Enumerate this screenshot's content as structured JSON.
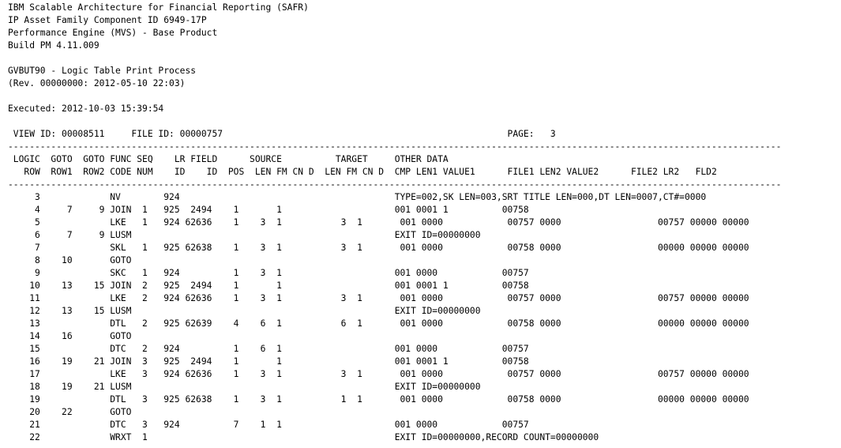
{
  "header": [
    "IBM Scalable Architecture for Financial Reporting (SAFR)",
    "IP Asset Family Component ID 6949-17P",
    "Performance Engine (MVS) - Base Product",
    "Build PM 4.11.009",
    "",
    "GVBUT90 - Logic Table Print Process",
    "(Rev. 00000000: 2012-05-10 22:03)",
    "",
    "Executed: 2012-10-03 15:39:54",
    "",
    " VIEW ID: 00008511     FILE ID: 00000757                                                     PAGE:   3"
  ],
  "rule": "------------------------------------------------------------------------------------------------------------------------------------------------",
  "column_headers": [
    " LOGIC  GOTO  GOTO FUNC SEQ    LR FIELD      SOURCE          TARGET     OTHER DATA",
    "   ROW  ROW1  ROW2 CODE NUM    ID    ID  POS  LEN FM CN D  LEN FM CN D  CMP LEN1 VALUE1      FILE1 LEN2 VALUE2      FILE2 LR2   FLD2"
  ],
  "rows": [
    "     3             NV        924                                        TYPE=002,SK LEN=003,SRT TITLE LEN=000,DT LEN=0007,CT#=0000",
    "     4     7     9 JOIN  1   925  2494    1       1                     001 0001 1          00758",
    "     5             LKE   1   924 62636    1    3  1           3  1       001 0000            00757 0000                  00757 00000 00000",
    "     6     7     9 LUSM                                                 EXIT ID=00000000",
    "     7             SKL   1   925 62638    1    3  1           3  1       001 0000            00758 0000                  00000 00000 00000",
    "     8    10       GOTO",
    "     9             SKC   1   924          1    3  1                     001 0000            00757",
    "    10    13    15 JOIN  2   925  2494    1       1                     001 0001 1          00758",
    "    11             LKE   2   924 62636    1    3  1           3  1       001 0000            00757 0000                  00757 00000 00000",
    "    12    13    15 LUSM                                                 EXIT ID=00000000",
    "    13             DTL   2   925 62639    4    6  1           6  1       001 0000            00758 0000                  00000 00000 00000",
    "    14    16       GOTO",
    "    15             DTC   2   924          1    6  1                     001 0000            00757",
    "    16    19    21 JOIN  3   925  2494    1       1                     001 0001 1          00758",
    "    17             LKE   3   924 62636    1    3  1           3  1       001 0000            00757 0000                  00757 00000 00000",
    "    18    19    21 LUSM                                                 EXIT ID=00000000",
    "    19             DTL   3   925 62638    1    3  1           1  1       001 0000            00758 0000                  00000 00000 00000",
    "    20    22       GOTO",
    "    21             DTC   3   924          7    1  1                     001 0000            00757",
    "    22             WRXT  1                                              EXIT ID=00000000,RECORD COUNT=00000000"
  ]
}
